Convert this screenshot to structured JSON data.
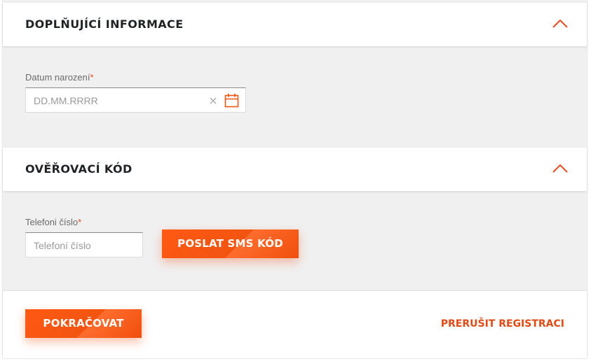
{
  "section1": {
    "title": "DOPLŇUJÍCÍ INFORMACE"
  },
  "birthdate": {
    "label": "Datum narození",
    "required_mark": "*",
    "placeholder": "DD.MM.RRRR"
  },
  "section2": {
    "title": "OVĚŘOVACÍ KÓD"
  },
  "phone": {
    "label": "Telefoni číslo",
    "required_mark": "*",
    "placeholder": "Telefoní číslo"
  },
  "buttons": {
    "send_sms": "POSLAT SMS KÓD",
    "continue": "POKRAČOVAT",
    "cancel": "PRERUŠIT REGISTRACI"
  },
  "colors": {
    "accent": "#f25410",
    "background": "#f0f0f0",
    "title": "#1f2326"
  },
  "icons": {
    "collapse": "chevron-up-icon",
    "clear": "clear-x-icon",
    "calendar": "calendar-icon"
  }
}
